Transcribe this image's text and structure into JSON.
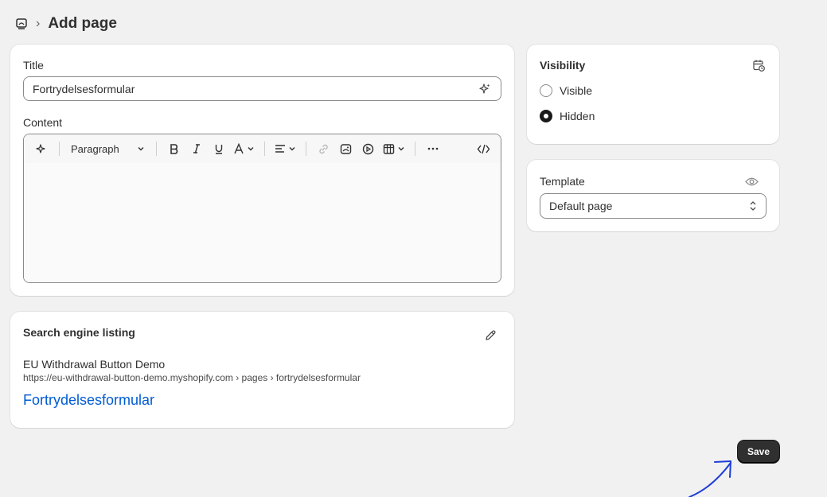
{
  "header": {
    "title": "Add page"
  },
  "title_section": {
    "label": "Title",
    "value": "Fortrydelsesformular"
  },
  "content_section": {
    "label": "Content",
    "paragraph_style": "Paragraph"
  },
  "seo": {
    "title": "Search engine listing",
    "store_name": "EU Withdrawal Button Demo",
    "url": "https://eu-withdrawal-button-demo.myshopify.com › pages › fortrydelsesformular",
    "page_title": "Fortrydelsesformular"
  },
  "visibility": {
    "title": "Visibility",
    "options": [
      {
        "label": "Visible",
        "checked": false
      },
      {
        "label": "Hidden",
        "checked": true
      }
    ]
  },
  "template": {
    "label": "Template",
    "selected": "Default page"
  },
  "actions": {
    "save_label": "Save"
  },
  "colors": {
    "background": "#f1f1f1",
    "link": "#005bd3",
    "primary_button": "#303030",
    "annotation_arrow": "#1f3fd8"
  }
}
